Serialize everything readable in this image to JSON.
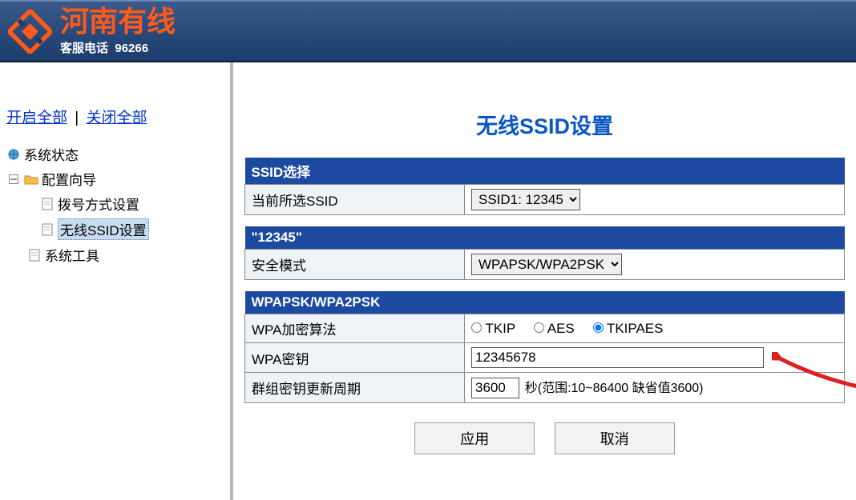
{
  "header": {
    "brand": "河南有线",
    "hotline_label": "客服电话",
    "hotline_number": "96266"
  },
  "sidebar": {
    "expand_all": "开启全部",
    "collapse_all": "关闭全部",
    "nodes": {
      "system_status": "系统状态",
      "config_wizard": "配置向导",
      "dial_setting": "拨号方式设置",
      "ssid_setting": "无线SSID设置",
      "system_tools": "系统工具"
    }
  },
  "page": {
    "title": "无线SSID设置",
    "ssid_section": {
      "header": "SSID选择",
      "current_label": "当前所选SSID",
      "selected_value": "SSID1: 12345"
    },
    "ssid_name_section": {
      "header": "\"12345\"",
      "security_label": "安全模式",
      "security_value": "WPAPSK/WPA2PSK"
    },
    "wpa_section": {
      "header": "WPAPSK/WPA2PSK",
      "algo_label": "WPA加密算法",
      "algo_tkip": "TKIP",
      "algo_aes": "AES",
      "algo_tkipaes": "TKIPAES",
      "key_label": "WPA密钥",
      "key_value": "12345678",
      "renew_label": "群组密钥更新周期",
      "renew_value": "3600",
      "renew_hint": "秒(范围:10~86400 缺省值3600)"
    },
    "buttons": {
      "apply": "应用",
      "cancel": "取消"
    }
  }
}
